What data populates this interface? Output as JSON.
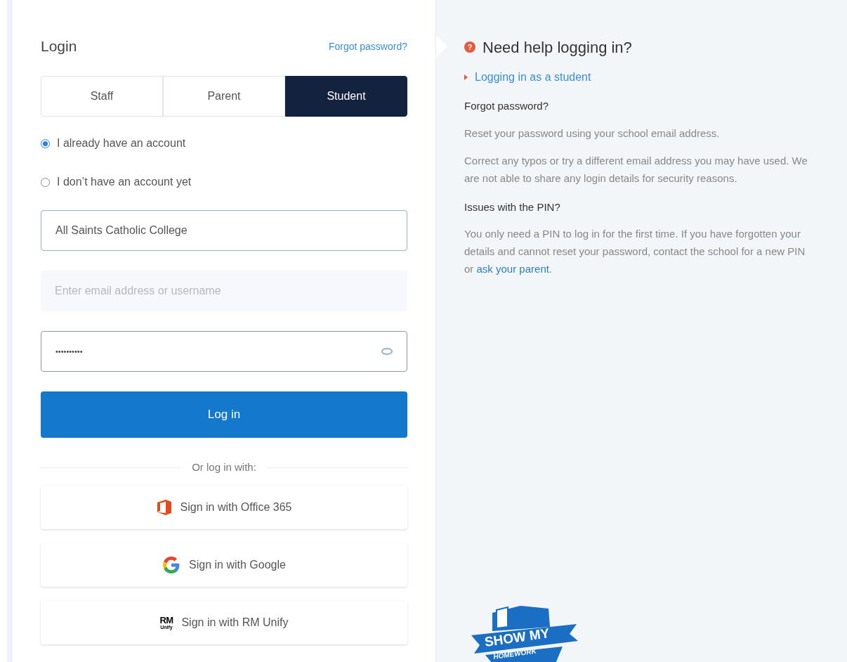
{
  "login": {
    "title": "Login",
    "forgot_link": "Forgot password?",
    "tabs": [
      {
        "label": "Staff",
        "selected": false
      },
      {
        "label": "Parent",
        "selected": false
      },
      {
        "label": "Student",
        "selected": true
      }
    ],
    "account_options": [
      {
        "label": "I already have an account",
        "selected": true
      },
      {
        "label": "I don’t have an account yet",
        "selected": false
      }
    ],
    "school_field": {
      "value": "All Saints Catholic College"
    },
    "username_field": {
      "placeholder": "Enter email address or username"
    },
    "password_field": {
      "value": "••••••••••"
    },
    "login_button": "Log in",
    "divider": "Or log in with:",
    "sso_buttons": [
      {
        "kind": "office",
        "label": "Sign in with Office 365"
      },
      {
        "kind": "google",
        "label": "Sign in with Google"
      },
      {
        "kind": "rm",
        "label": "Sign in with RM Unify",
        "icon_text": [
          "RM",
          "Unify"
        ]
      }
    ]
  },
  "help": {
    "icon_text": "?",
    "title": "Need help logging in?",
    "link": "Logging in as a student",
    "sections": [
      {
        "heading": "Forgot password?",
        "paragraphs": [
          {
            "text": "Reset your password using your school email address."
          },
          {
            "text": "Correct any typos or try a different email address you may have used. We are not able to share any login details for security reasons."
          }
        ]
      },
      {
        "heading": "Issues with the PIN?",
        "paragraphs": [
          {
            "text": "You only need a PIN to log in for the first time. If you have forgotten your details and cannot reset your password, contact the school for a new PIN or",
            "link": "ask your parent",
            "after": "."
          }
        ]
      }
    ],
    "logo": {
      "line1": "SHOW MY",
      "line2": "HOMEWORK"
    }
  }
}
